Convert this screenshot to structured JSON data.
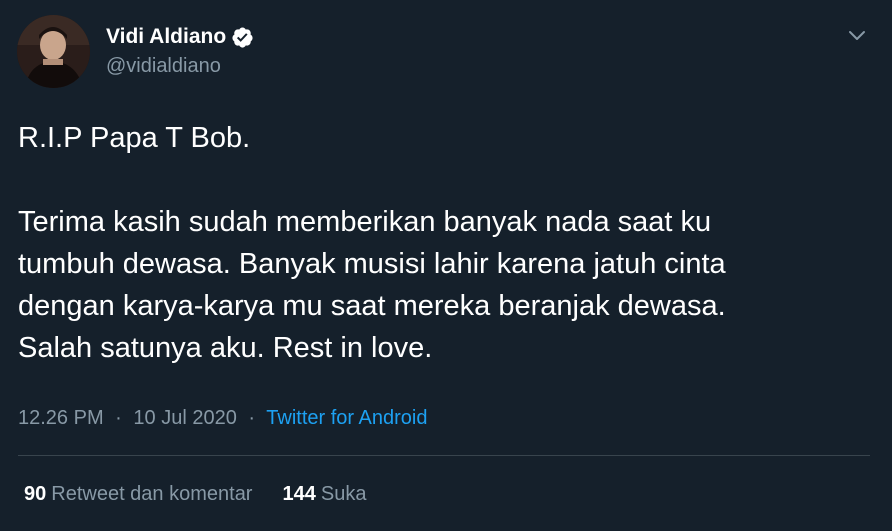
{
  "author": {
    "display_name": "Vidi Aldiano",
    "handle": "@vidialdiano",
    "verified": true
  },
  "tweet": {
    "line1": "R.I.P Papa T Bob.",
    "line2": "Terima kasih sudah memberikan banyak nada saat ku",
    "line3": "tumbuh dewasa. Banyak musisi lahir karena jatuh cinta",
    "line4": "dengan karya-karya mu saat mereka beranjak dewasa.",
    "line5": "Salah satunya aku. Rest in love."
  },
  "meta": {
    "time": "12.26 PM",
    "separator1": "·",
    "date": "10 Jul 2020",
    "separator2": "·",
    "source": "Twitter for Android"
  },
  "stats": {
    "retweets_count": "90",
    "retweets_label": "Retweet dan komentar",
    "likes_count": "144",
    "likes_label": "Suka"
  },
  "colors": {
    "background": "#15202b",
    "text": "#ffffff",
    "secondary": "#8899a6",
    "link": "#1da1f2",
    "divider": "#38444d"
  },
  "icons": {
    "verified": "verified-badge-icon",
    "menu": "chevron-down-icon"
  }
}
